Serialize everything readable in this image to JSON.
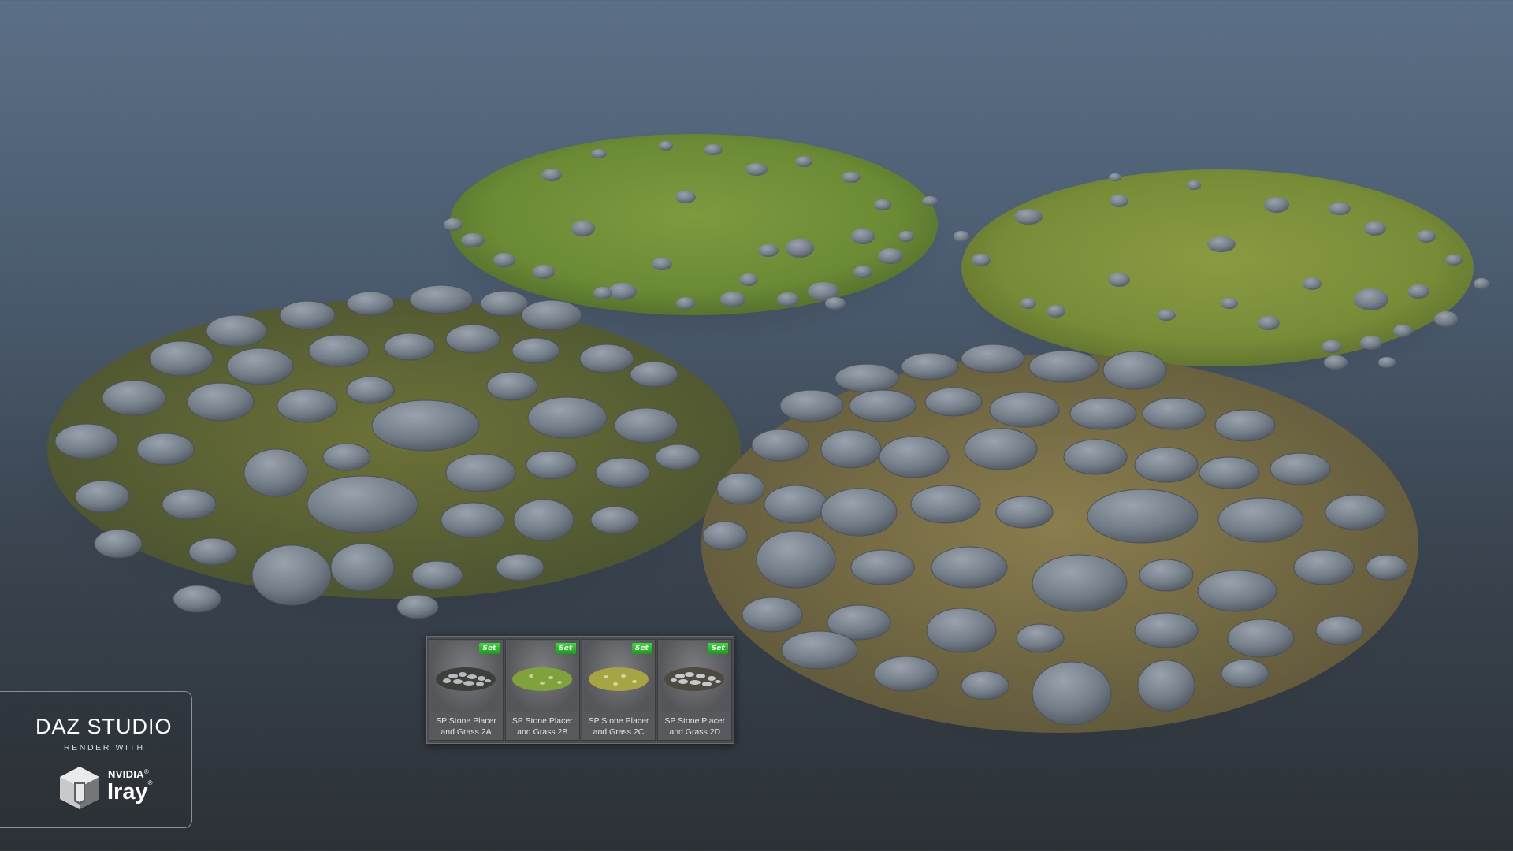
{
  "colors": {
    "background_top": "#5b6f86",
    "background_bottom": "#2c3136",
    "grass": "#6f8f3a",
    "stone": "#6f7882",
    "set_badge": "#2fb82f"
  },
  "content_strip": {
    "items": [
      {
        "badge": "Set",
        "label_line1": "SP Stone Placer",
        "label_line2": "and Grass 2A",
        "thumb": "stone-heavy"
      },
      {
        "badge": "Set",
        "label_line1": "SP Stone Placer",
        "label_line2": "and Grass 2B",
        "thumb": "grass-green"
      },
      {
        "badge": "Set",
        "label_line1": "SP Stone Placer",
        "label_line2": "and Grass 2C",
        "thumb": "grass-dry"
      },
      {
        "badge": "Set",
        "label_line1": "SP Stone Placer",
        "label_line2": "and Grass 2D",
        "thumb": "stone-dry"
      }
    ]
  },
  "logo": {
    "title": "DAZ STUDIO",
    "subtitle": "RENDER WITH",
    "nvidia": "NVIDIA",
    "iray": "Iray",
    "reg_mark": "®",
    "icon": "iray-cube-icon"
  }
}
